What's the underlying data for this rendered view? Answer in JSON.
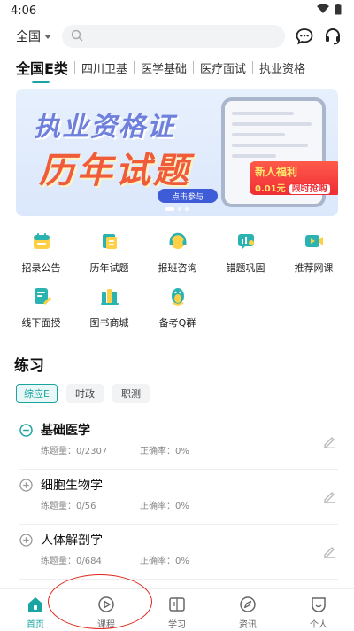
{
  "status_bar": {
    "time": "4:06"
  },
  "top_bar": {
    "region": "全国",
    "search_placeholder": ""
  },
  "category_tabs": [
    "全国E类",
    "四川卫基",
    "医学基础",
    "医疗面试",
    "执业资格"
  ],
  "banner": {
    "title_line1": "执业资格证",
    "title_line2": "历年试题",
    "button": "点击参与",
    "promo_title": "新人福利",
    "promo_price": "0.01元",
    "promo_tag": "限时抢购"
  },
  "features": [
    {
      "label": "招录公告",
      "icon": "calendar-icon"
    },
    {
      "label": "历年试题",
      "icon": "scroll-icon"
    },
    {
      "label": "报班咨询",
      "icon": "headset-icon"
    },
    {
      "label": "错题巩固",
      "icon": "chart-bubble-icon"
    },
    {
      "label": "推荐网课",
      "icon": "video-icon"
    },
    {
      "label": "线下面授",
      "icon": "document-edit-icon"
    },
    {
      "label": "图书商城",
      "icon": "books-icon"
    },
    {
      "label": "备考Q群",
      "icon": "penguin-icon"
    }
  ],
  "practice": {
    "title": "练习",
    "tabs": [
      "综应E",
      "时政",
      "职测"
    ],
    "items": [
      {
        "name": "基础医学",
        "count": "练题量：0/2307",
        "accuracy": "正确率：0%"
      },
      {
        "name": "细胞生物学",
        "count": "练题量：0/56",
        "accuracy": "正确率：0%"
      },
      {
        "name": "人体解剖学",
        "count": "练题量：0/684",
        "accuracy": "正确率：0%"
      }
    ]
  },
  "bottom_nav": [
    {
      "label": "首页",
      "icon": "home-icon"
    },
    {
      "label": "课程",
      "icon": "play-circle-icon"
    },
    {
      "label": "学习",
      "icon": "book-open-icon"
    },
    {
      "label": "资讯",
      "icon": "compass-icon"
    },
    {
      "label": "个人",
      "icon": "smile-icon"
    }
  ],
  "colors": {
    "accent": "#1aa5a2",
    "banner_red": "#f05b3a",
    "annotation_red": "#e0251b"
  }
}
